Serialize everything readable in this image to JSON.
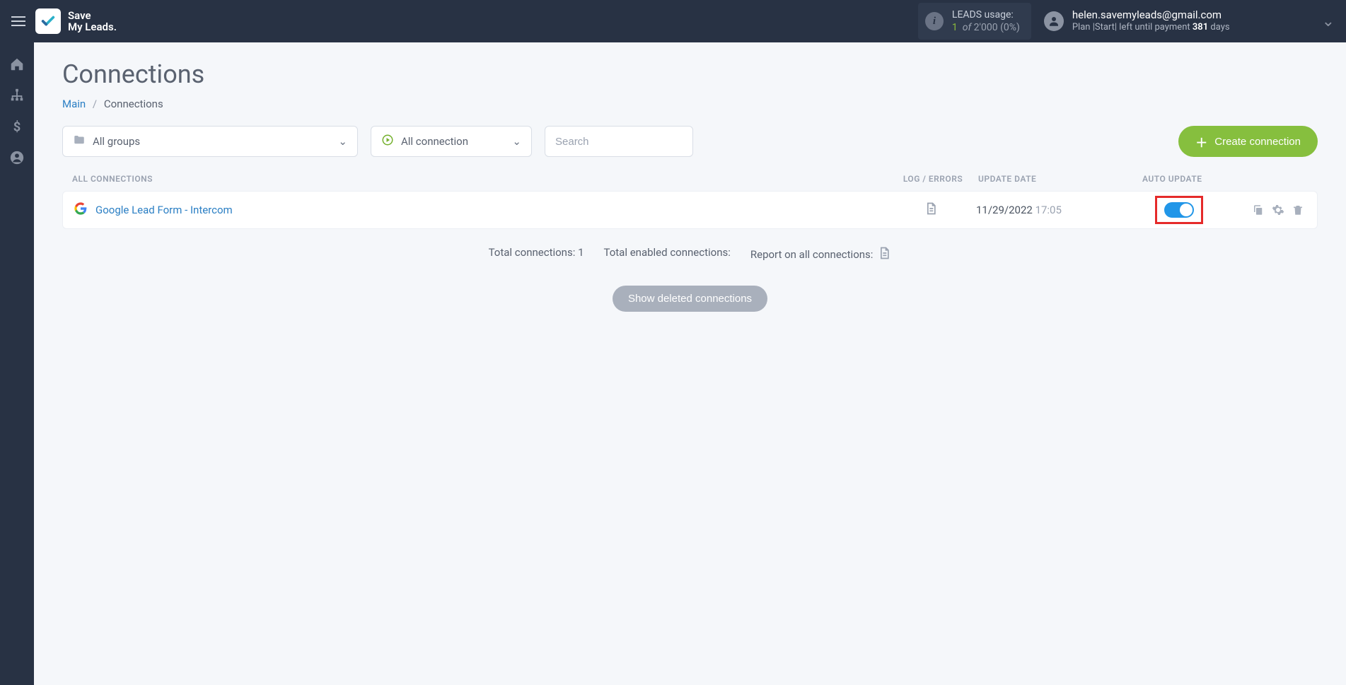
{
  "brand": {
    "line1": "Save",
    "line2": "My Leads."
  },
  "usage": {
    "title": "LEADS usage:",
    "count": "1",
    "of_label": "of",
    "limit": "2'000",
    "pct": "(0%)"
  },
  "user": {
    "email": "helen.savemyleads@gmail.com",
    "plan_line_prefix": "Plan |Start|  left until payment ",
    "days": "381",
    "days_suffix": " days"
  },
  "page": {
    "title": "Connections",
    "breadcrumb_main": "Main",
    "breadcrumb_current": "Connections"
  },
  "filters": {
    "groups": "All groups",
    "connection": "All connection",
    "search_placeholder": "Search"
  },
  "create_button": "Create connection",
  "table": {
    "header_all": "ALL CONNECTIONS",
    "header_log": "LOG / ERRORS",
    "header_date": "UPDATE DATE",
    "header_auto": "AUTO UPDATE"
  },
  "rows": [
    {
      "name": "Google Lead Form - Intercom",
      "date": "11/29/2022",
      "time": "17:05"
    }
  ],
  "summary": {
    "total_label": "Total connections: ",
    "total_value": "1",
    "enabled_label": "Total enabled connections:",
    "report_label": "Report on all connections:"
  },
  "show_deleted": "Show deleted connections"
}
